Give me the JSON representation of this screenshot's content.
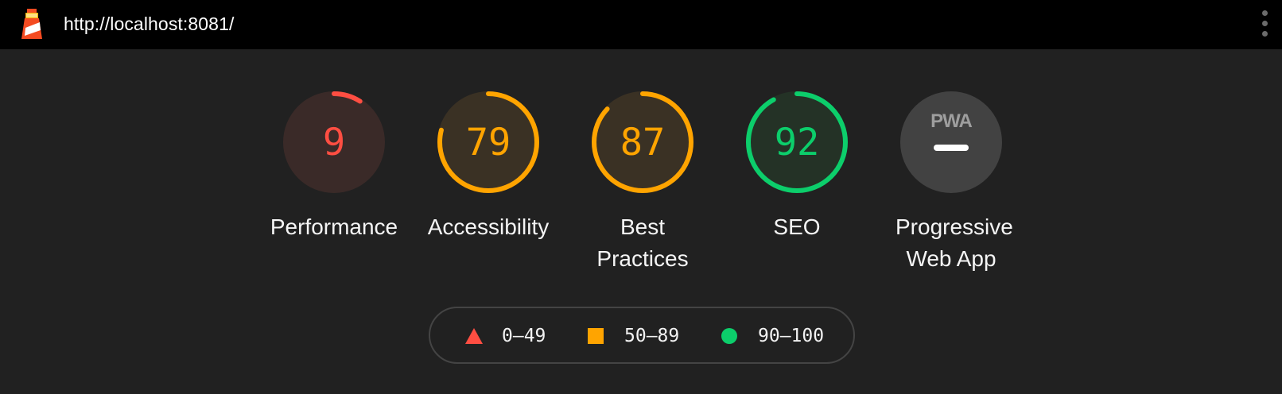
{
  "topbar": {
    "url": "http://localhost:8081/",
    "logo_icon": "lighthouse-icon",
    "menu_icon": "kebab-menu-icon"
  },
  "colors": {
    "fail": "#ff4e42",
    "average": "#ffa400",
    "pass": "#0cce6b",
    "pwa_bg": "#424242",
    "pwa_fg": "#9e9e9e"
  },
  "gauges": [
    {
      "id": "performance",
      "score": "9",
      "value": 0.09,
      "rating": "fail",
      "label": "Performance"
    },
    {
      "id": "accessibility",
      "score": "79",
      "value": 0.79,
      "rating": "average",
      "label": "Accessibility"
    },
    {
      "id": "best-practices",
      "score": "87",
      "value": 0.87,
      "rating": "average",
      "label": "Best Practices"
    },
    {
      "id": "seo",
      "score": "92",
      "value": 0.92,
      "rating": "pass",
      "label": "SEO"
    }
  ],
  "pwa": {
    "badge": "PWA",
    "label": "Progressive Web App",
    "icon": "pwa-icon"
  },
  "legend": [
    {
      "shape": "triangle",
      "range": "0–49",
      "rating": "fail"
    },
    {
      "shape": "square",
      "range": "50–89",
      "rating": "average"
    },
    {
      "shape": "circle",
      "range": "90–100",
      "rating": "pass"
    }
  ]
}
